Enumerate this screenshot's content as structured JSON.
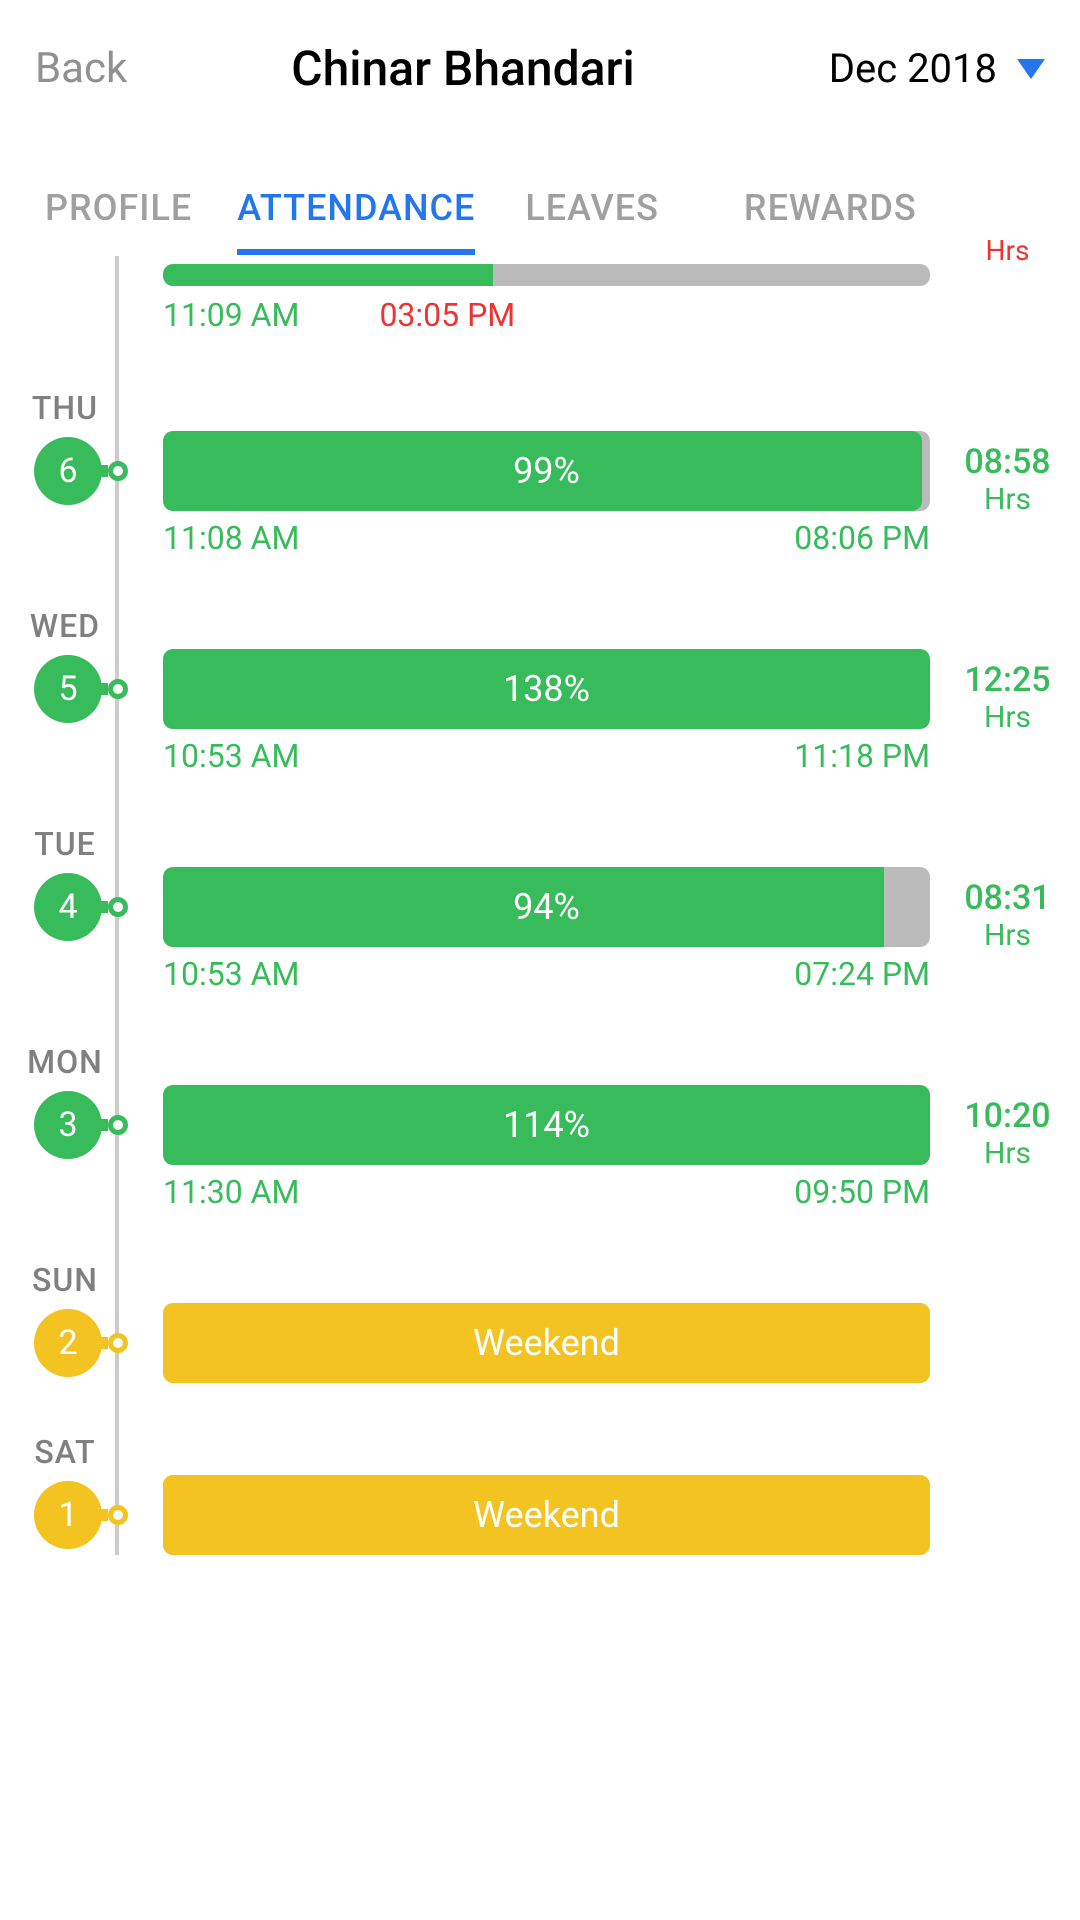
{
  "header": {
    "back": "Back",
    "title": "Chinar Bhandari",
    "month": "Dec 2018"
  },
  "tabs": {
    "profile": "PROFILE",
    "attendance": "ATTENDANCE",
    "leaves": "LEAVES",
    "rewards": "REWARDS"
  },
  "entries": {
    "cut": {
      "in": "11:09 AM",
      "out": "03:05 PM",
      "hrs_cut": "Hrs"
    },
    "thu": {
      "day": "THU",
      "num": "6",
      "percent": "99%",
      "in": "11:08 AM",
      "out": "08:06 PM",
      "hours": "08:58",
      "hrs": "Hrs"
    },
    "wed": {
      "day": "WED",
      "num": "5",
      "percent": "138%",
      "in": "10:53 AM",
      "out": "11:18 PM",
      "hours": "12:25",
      "hrs": "Hrs"
    },
    "tue": {
      "day": "TUE",
      "num": "4",
      "percent": "94%",
      "in": "10:53 AM",
      "out": "07:24 PM",
      "hours": "08:31",
      "hrs": "Hrs"
    },
    "mon": {
      "day": "MON",
      "num": "3",
      "percent": "114%",
      "in": "11:30 AM",
      "out": "09:50 PM",
      "hours": "10:20",
      "hrs": "Hrs"
    },
    "sun": {
      "day": "SUN",
      "num": "2",
      "label": "Weekend"
    },
    "sat": {
      "day": "SAT",
      "num": "1",
      "label": "Weekend"
    }
  }
}
